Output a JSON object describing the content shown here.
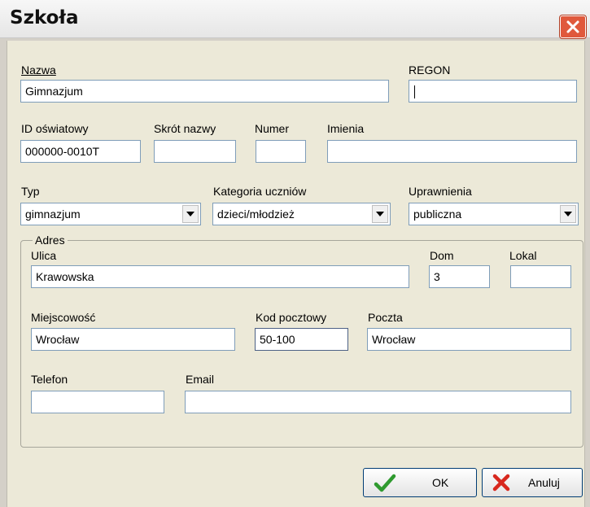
{
  "window": {
    "title": "Szkoła"
  },
  "icons": {
    "close": "close-icon",
    "ok": "checkmark-icon",
    "cancel": "cross-icon",
    "dropdown": "chevron-down-icon"
  },
  "colors": {
    "close_bg": "#e0593c",
    "ok_check": "#2f9a2f",
    "cancel_x": "#d8281e"
  },
  "fields": {
    "nazwa": {
      "label": "Nazwa",
      "value": "Gimnazjum"
    },
    "regon": {
      "label": "REGON",
      "value": ""
    },
    "id_oswiatowy": {
      "label": "ID oświatowy",
      "value": "000000-0010T"
    },
    "skrot_nazwy": {
      "label": "Skrót nazwy",
      "value": ""
    },
    "numer": {
      "label": "Numer",
      "value": ""
    },
    "imienia": {
      "label": "Imienia",
      "value": ""
    },
    "typ": {
      "label": "Typ",
      "value": "gimnazjum"
    },
    "kategoria": {
      "label": "Kategoria uczniów",
      "value": "dzieci/młodzież"
    },
    "uprawnienia": {
      "label": "Uprawnienia",
      "value": "publiczna"
    }
  },
  "adres": {
    "legend": "Adres",
    "ulica": {
      "label": "Ulica",
      "value": "Krawowska"
    },
    "dom": {
      "label": "Dom",
      "value": "3"
    },
    "lokal": {
      "label": "Lokal",
      "value": ""
    },
    "miejscowosc": {
      "label": "Miejscowość",
      "value": "Wrocław"
    },
    "kod": {
      "label": "Kod pocztowy",
      "value": "50-100"
    },
    "poczta": {
      "label": "Poczta",
      "value": "Wrocław"
    },
    "telefon": {
      "label": "Telefon",
      "value": ""
    },
    "email": {
      "label": "Email",
      "value": ""
    }
  },
  "buttons": {
    "ok": "OK",
    "cancel": "Anuluj"
  }
}
